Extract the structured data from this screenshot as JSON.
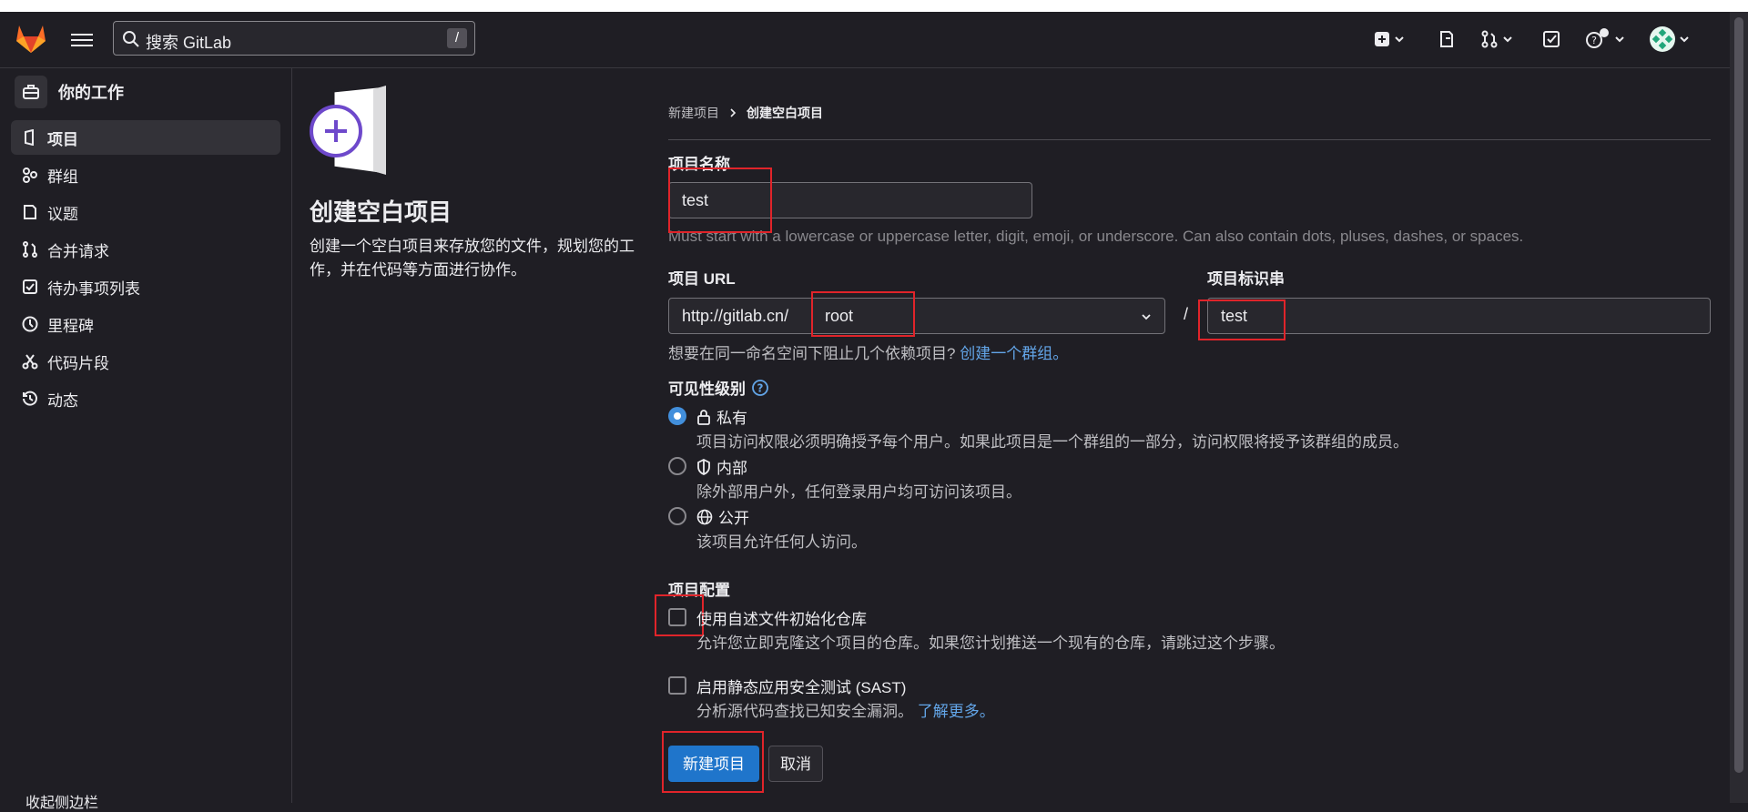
{
  "topbar": {
    "search_placeholder": "搜索 GitLab",
    "search_shortcut": "/"
  },
  "sidebar": {
    "heading": "你的工作",
    "items": [
      {
        "label": "项目",
        "icon": "project-icon"
      },
      {
        "label": "群组",
        "icon": "group-icon"
      },
      {
        "label": "议题",
        "icon": "issues-icon"
      },
      {
        "label": "合并请求",
        "icon": "merge-request-icon"
      },
      {
        "label": "待办事项列表",
        "icon": "todo-icon"
      },
      {
        "label": "里程碑",
        "icon": "milestone-icon"
      },
      {
        "label": "代码片段",
        "icon": "snippet-icon"
      },
      {
        "label": "动态",
        "icon": "activity-icon"
      }
    ],
    "collapse_label": "收起侧边栏"
  },
  "left_panel": {
    "title": "创建空白项目",
    "description": "创建一个空白项目来存放您的文件，规划您的工作，并在代码等方面进行协作。"
  },
  "breadcrumb": {
    "parent": "新建项目",
    "current": "创建空白项目"
  },
  "form": {
    "name_label": "项目名称",
    "name_value": "test",
    "name_help": "Must start with a lowercase or uppercase letter, digit, emoji, or underscore. Can also contain dots, pluses, dashes, or spaces.",
    "url_label": "项目 URL",
    "url_prefix": "http://gitlab.cn/",
    "namespace_value": "root",
    "slash": "/",
    "slug_label": "项目标识串",
    "slug_value": "test",
    "group_hint": "想要在同一命名空间下阻止几个依赖项目?",
    "group_link": "创建一个群组。",
    "visibility_label": "可见性级别",
    "visibility_options": [
      {
        "label": "私有",
        "desc": "项目访问权限必须明确授予每个用户。如果此项目是一个群组的一部分，访问权限将授予该群组的成员。",
        "selected": true
      },
      {
        "label": "内部",
        "desc": "除外部用户外，任何登录用户均可访问该项目。",
        "selected": false
      },
      {
        "label": "公开",
        "desc": "该项目允许任何人访问。",
        "selected": false
      }
    ],
    "config_label": "项目配置",
    "readme_label": "使用自述文件初始化仓库",
    "readme_desc": "允许您立即克隆这个项目的仓库。如果您计划推送一个现有的仓库，请跳过这个步骤。",
    "sast_label": "启用静态应用安全测试 (SAST)",
    "sast_desc": "分析源代码查找已知安全漏洞。",
    "sast_link": "了解更多。",
    "submit": "新建项目",
    "cancel": "取消"
  }
}
